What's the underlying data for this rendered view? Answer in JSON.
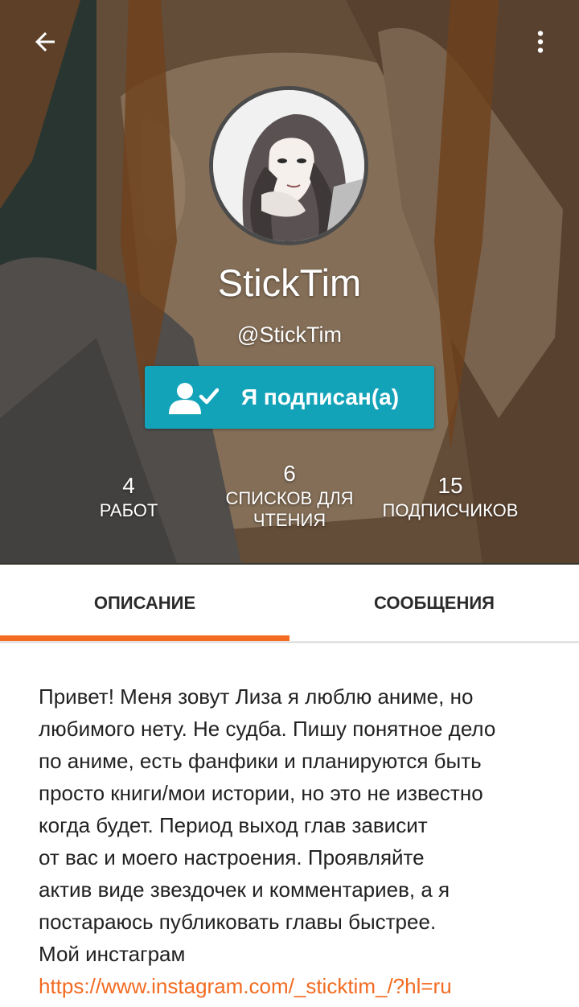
{
  "topbar": {
    "back_icon": "arrow-left-icon",
    "more_icon": "more-vertical-icon"
  },
  "profile": {
    "display_name": "StickTim",
    "username": "@StickTim",
    "avatar_icon": "user-avatar-image"
  },
  "follow_button": {
    "label": "Я подписан(а)",
    "icon": "user-check-icon",
    "color": "#13a3b8"
  },
  "stats": {
    "works": {
      "value": "4",
      "label": "РАБОТ"
    },
    "reading_lists": {
      "value": "6",
      "label_line1": "СПИСКОВ ДЛЯ",
      "label_line2": "ЧТЕНИЯ"
    },
    "followers": {
      "value": "15",
      "label": "ПОДПИСЧИКОВ"
    }
  },
  "tabs": {
    "description": "ОПИСАНИЕ",
    "messages": "СООБЩЕНИЯ",
    "active": "description",
    "accent_color": "#f26b21"
  },
  "bio": {
    "lines": [
      "Привет! Меня зовут Лиза я люблю аниме, но",
      "любимого нету. Не судба. Пишу понятное дело",
      "по аниме, есть фанфики и планируются быть",
      "просто книги/мои истории, но это не известно",
      "когда будет. Период выход глав зависит",
      "от вас и моего настроения. Проявляйте",
      "актив виде звездочек и комментариев, а я",
      "постараюсь публиковать главы быстрее.",
      "Мой инстаграм"
    ],
    "link": "https://www.instagram.com/_sticktim_/?hl=ru",
    "link_color": "#f26b21"
  }
}
